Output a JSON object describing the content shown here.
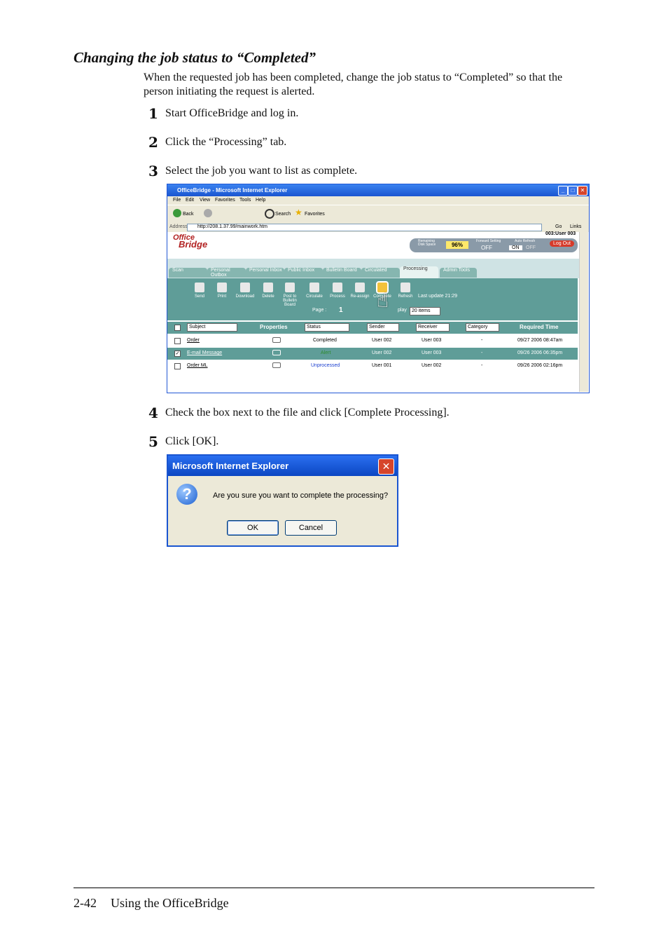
{
  "heading": "Changing the job status to “Completed”",
  "intro": "When the requested job has been completed, change the job status to “Completed” so that the person initiating the request is alerted.",
  "steps": [
    {
      "num": "1",
      "text": "Start OfficeBridge and log in."
    },
    {
      "num": "2",
      "text": "Click the “Processing” tab."
    },
    {
      "num": "3",
      "text": "Select the job you want to list as complete."
    },
    {
      "num": "4",
      "text": "Check the box next to the file and click [Complete Processing]."
    },
    {
      "num": "5",
      "text": "Click [OK]."
    }
  ],
  "screenshot": {
    "title": "OfficeBridge - Microsoft Internet Explorer",
    "menu": [
      "File",
      "Edit",
      "View",
      "Favorites",
      "Tools",
      "Help"
    ],
    "toolbar": {
      "back": "Back",
      "search": "Search",
      "favorites": "Favorites"
    },
    "address_label": "Address",
    "address_url": "http://208.1.37.99/mainwork.htm",
    "go": "Go",
    "links": "Links",
    "logo_top": "Office",
    "logo_bottom": "Bridge",
    "user": "003:User 003",
    "disk_label": "Remaining Disk Space",
    "disk_value": "96%",
    "forward_label": "Forward Setting",
    "forward_value": "OFF",
    "auto_label": "Auto Refresh",
    "auto_on": "ON",
    "auto_off": "OFF",
    "logout": "Log Out",
    "tabs": [
      "Scan",
      "Personal Outbox",
      "Personal Inbox",
      "Public Inbox",
      "Bulletin Board",
      "Circulated",
      "Processing",
      "Admin Tools"
    ],
    "commands": [
      "Send",
      "Print",
      "Download",
      "Delete",
      "Post to Bulletin Board",
      "Circulate",
      "Process",
      "Re-assign",
      "Complete",
      "Refresh"
    ],
    "last_update": "Last update  21:29",
    "page_label": "Page :",
    "page_num": "1",
    "display_label": "play",
    "display_value": "20 items",
    "columns": {
      "subject": "Subject",
      "properties": "Properties",
      "status": "Status",
      "sender": "Sender",
      "receiver": "Receiver",
      "category": "Category",
      "time": "Required Time"
    },
    "rows": [
      {
        "subject": "Order",
        "status": "Completed",
        "sender": "User 002",
        "receiver": "User 003",
        "category": "-",
        "time": "09/27 2006 08:47am",
        "checked": false
      },
      {
        "subject": "E-mail Message",
        "status": "Alert",
        "sender": "User 002",
        "receiver": "User 003",
        "category": "-",
        "time": "09/26 2006 06:35pm",
        "checked": true
      },
      {
        "subject": "Order ML",
        "status": "Unprocessed",
        "sender": "User 001",
        "receiver": "User 002",
        "category": "-",
        "time": "09/26 2006 02:16pm",
        "checked": false
      }
    ]
  },
  "dialog": {
    "title": "Microsoft Internet Explorer",
    "message": "Are you sure you want to complete the processing?",
    "ok": "OK",
    "cancel": "Cancel"
  },
  "footer": {
    "page": "2-42",
    "text": "Using the OfficeBridge"
  },
  "colors": {
    "teal": "#5f9d98",
    "ie_blue": "#1a55d0"
  }
}
